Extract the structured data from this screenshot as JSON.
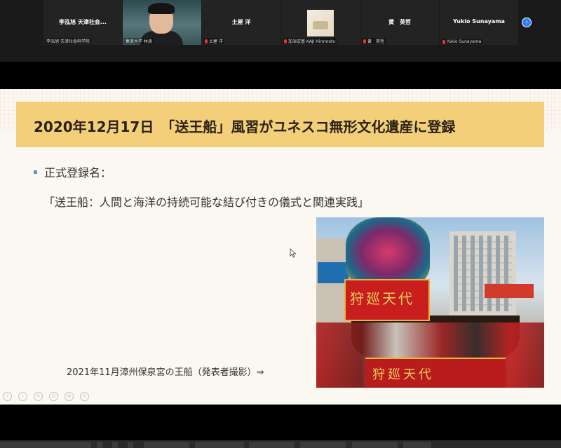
{
  "participants": [
    {
      "center_name": "李泓旭 天津社会...",
      "label": "李泓旭 天津社会科学院",
      "type": "name"
    },
    {
      "center_name": "",
      "label": "集美大学 林涛",
      "type": "video"
    },
    {
      "center_name": "土屋 洋",
      "label": "土屋 洋",
      "type": "name"
    },
    {
      "center_name": "",
      "label": "加治宏基 KAJI Hiromoto",
      "type": "image"
    },
    {
      "center_name": "黄　英哲",
      "label": "黄　英哲",
      "type": "name"
    },
    {
      "center_name": "Yukio Sunayama",
      "label": "Yukio Sunayama",
      "type": "name"
    }
  ],
  "next_label": "›",
  "slide": {
    "title": "2020年12月17日　「送王船」風習がユネスコ無形文化遺産に登録",
    "bullet": "正式登録名：",
    "official_name": "「送王船：人間と海洋の持続可能な結び付きの儀式と関連実践」",
    "caption": "2021年11月漳州保泉宮の王船（発表者撮影）⇒",
    "photo_banner_text": "狩廵天代",
    "photo_bottom_text": "狩廵天代"
  },
  "controls": [
    "‹",
    "›",
    "✎",
    "⊡",
    "⊕",
    "⊖"
  ],
  "colors": {
    "title_bar": "#f3cf79",
    "slide_bg": "#fbf7f1",
    "bullet": "#4aa0b0",
    "accent_blue": "#2d7ff9"
  }
}
